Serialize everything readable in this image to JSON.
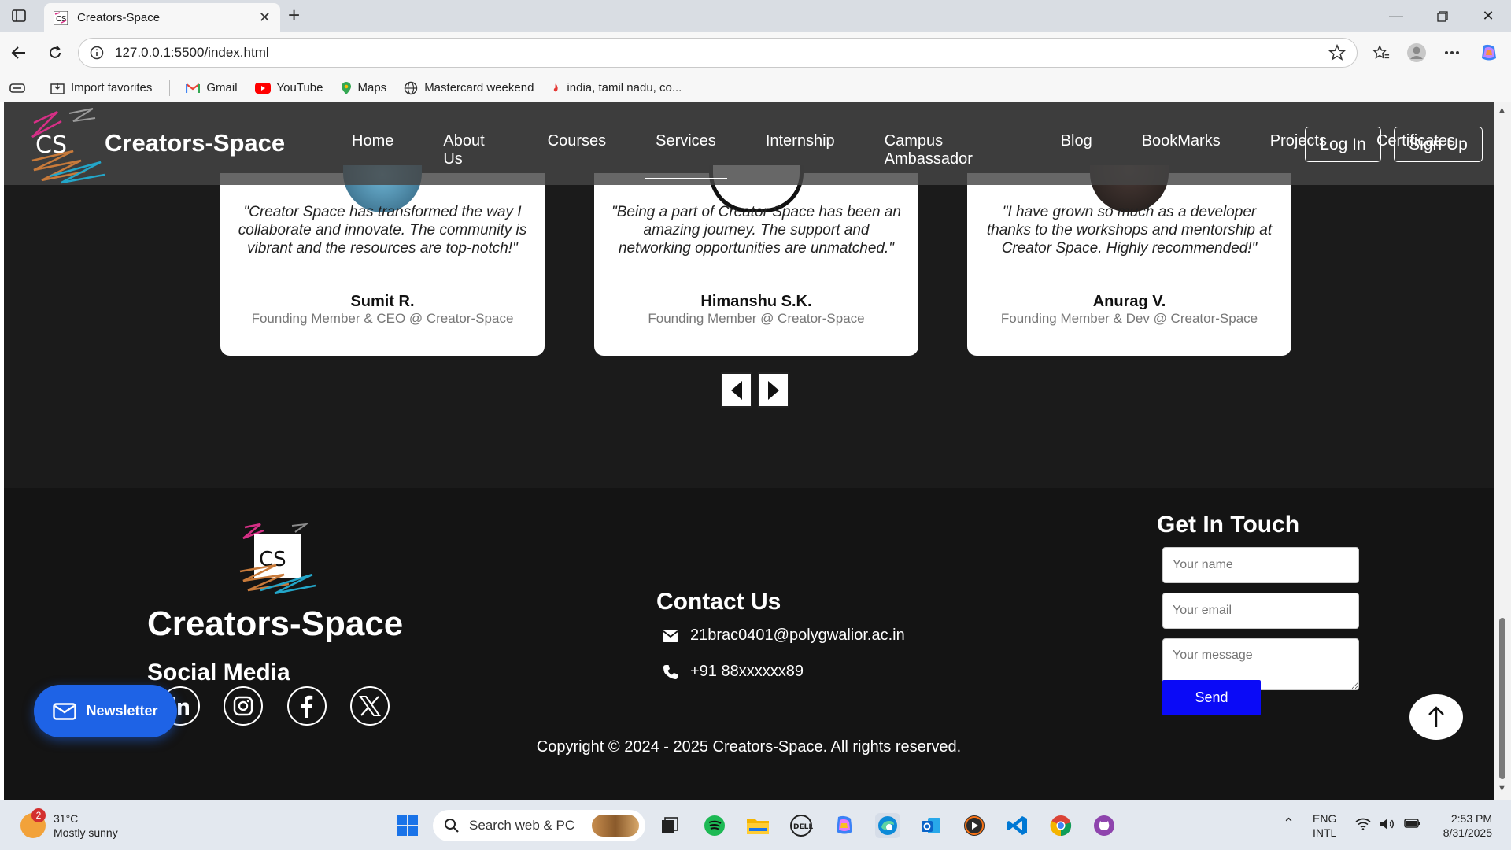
{
  "browser": {
    "tab_title": "Creators-Space",
    "url": "127.0.0.1:5500/index.html",
    "bookmarks": [
      {
        "label": "Import favorites",
        "icon": "import-icon"
      },
      {
        "label": "Gmail",
        "icon": "gmail-icon"
      },
      {
        "label": "YouTube",
        "icon": "youtube-icon"
      },
      {
        "label": "Maps",
        "icon": "maps-icon"
      },
      {
        "label": "Mastercard weekend",
        "icon": "globe-icon"
      },
      {
        "label": "india, tamil nadu, co...",
        "icon": "flame-icon"
      }
    ]
  },
  "navbar": {
    "logo_text": "CS",
    "brand": "Creators-Space",
    "links": [
      "Home",
      "About Us",
      "Courses",
      "Services",
      "Internship",
      "Campus Ambassador",
      "Blog",
      "BookMarks",
      "Projects",
      "Certificates"
    ],
    "active_link": "Services",
    "login_label": "Log In",
    "signup_label": "Sign Up"
  },
  "testimonials": [
    {
      "quote": "\"Creator Space has transformed the way I collaborate and innovate. The community is vibrant and the resources are top-notch!\"",
      "name": "Sumit R.",
      "role": "Founding Member & CEO @ Creator-Space"
    },
    {
      "quote": "\"Being a part of Creator Space has been an amazing journey. The support and networking opportunities are unmatched.\"",
      "name": "Himanshu S.K.",
      "role": "Founding Member @ Creator-Space"
    },
    {
      "quote": "\"I have grown so much as a developer thanks to the workshops and mentorship at Creator Space. Highly recommended!\"",
      "name": "Anurag V.",
      "role": "Founding Member & Dev @ Creator-Space"
    }
  ],
  "footer": {
    "logo_text": "CS",
    "brand": "Creators-Space",
    "social_title": "Social Media",
    "social_icons": [
      "linkedin-icon",
      "instagram-icon",
      "facebook-icon",
      "x-icon"
    ],
    "contact_title": "Contact Us",
    "email": "21brac0401@polygwalior.ac.in",
    "phone": "+91 88xxxxxx89",
    "get_in_touch_title": "Get In Touch",
    "name_placeholder": "Your name",
    "email_placeholder": "Your email",
    "message_placeholder": "Your message",
    "send_label": "Send",
    "copyright": "Copyright © 2024 - 2025 Creators-Space. All rights reserved.",
    "newsletter_label": "Newsletter"
  },
  "taskbar": {
    "weather_badge": "2",
    "temperature": "31°C",
    "condition": "Mostly sunny",
    "search_placeholder": "Search web & PC",
    "lang_top": "ENG",
    "lang_bottom": "INTL",
    "time": "2:53 PM",
    "date": "8/31/2025"
  },
  "colors": {
    "page_bg": "#1b1b1b",
    "footer_bg": "#141414",
    "send_button": "#0a0af7",
    "newsletter_button": "#1e63e6"
  }
}
